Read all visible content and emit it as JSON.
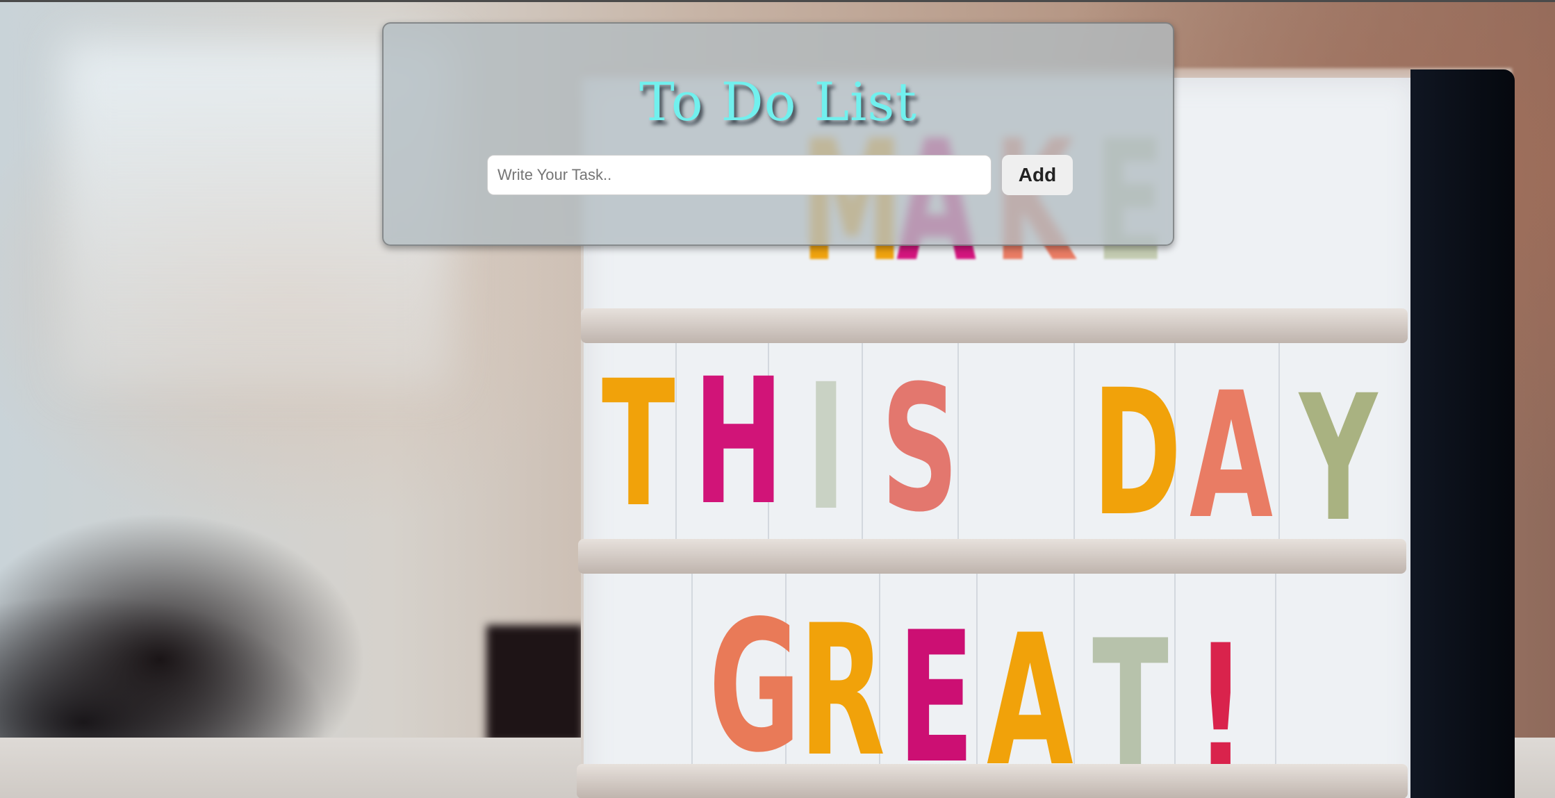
{
  "app": {
    "title": "To Do List"
  },
  "task_form": {
    "input_value": "",
    "input_placeholder": "Write Your Task..",
    "add_label": "Add"
  },
  "background": {
    "description_colors": {
      "title_color": "#71f0ee",
      "card_color": "#b2bcc2",
      "button_color": "#efefef"
    },
    "lightbox_rows": [
      {
        "letters": [
          "M",
          "A",
          "K",
          "E"
        ]
      },
      {
        "letters": [
          "T",
          "H",
          "I",
          "S",
          "D",
          "A",
          "Y"
        ]
      },
      {
        "letters": [
          "G",
          "R",
          "E",
          "A",
          "T",
          "!"
        ]
      }
    ]
  }
}
